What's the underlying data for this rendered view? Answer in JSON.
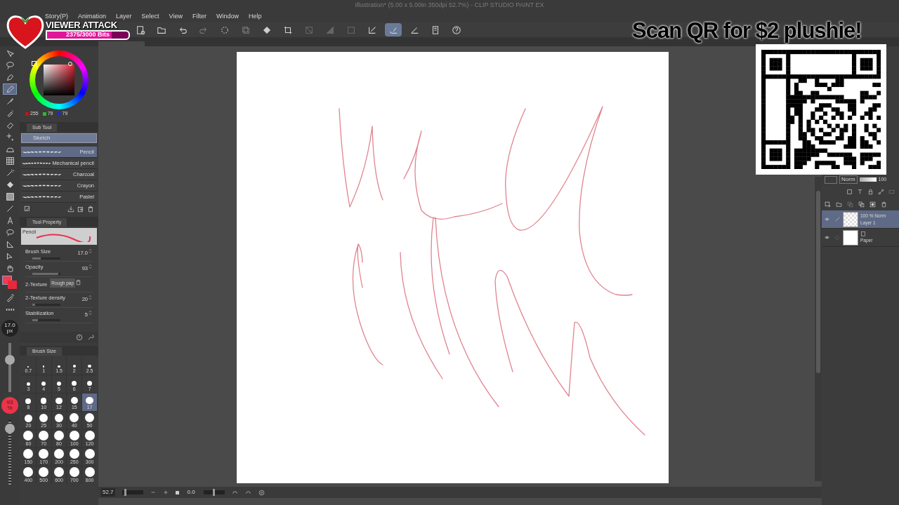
{
  "window": {
    "title": "Illustration* (5.00 x 5.00in 350dpi 52.7%) - CLIP STUDIO PAINT EX"
  },
  "menu": [
    "Story(P)",
    "Animation",
    "Layer",
    "Select",
    "View",
    "Filter",
    "Window",
    "Help"
  ],
  "toolbar": [
    {
      "selected": false
    },
    {
      "selected": false
    },
    {
      "selected": false
    },
    {
      "selected": false
    },
    {
      "selected": false
    },
    {
      "selected": false
    },
    {
      "selected": false
    },
    {
      "selected": false
    },
    {
      "selected": false
    },
    {
      "selected": false
    },
    {
      "selected": false
    },
    {
      "selected": false
    },
    {
      "selected": true
    },
    {
      "selected": false
    },
    {
      "selected": false
    },
    {
      "selected": false
    }
  ],
  "tools": [
    {
      "selected": false
    },
    {
      "selected": false
    },
    {
      "selected": false
    },
    {
      "selected": true
    },
    {
      "selected": false
    },
    {
      "selected": false
    },
    {
      "selected": false
    },
    {
      "selected": false
    },
    {
      "selected": false
    },
    {
      "selected": false
    },
    {
      "selected": false
    },
    {
      "selected": false
    },
    {
      "selected": false
    },
    {
      "selected": false
    },
    {
      "selected": false
    },
    {
      "selected": false
    },
    {
      "selected": false
    },
    {
      "selected": false
    },
    {
      "selected": false
    },
    {
      "selected": false
    },
    {
      "selected": false
    }
  ],
  "color": {
    "r": "255",
    "g": "79",
    "b": "79"
  },
  "sub_tool": {
    "tab": "Sub Tool",
    "group": "Sketch",
    "items": [
      {
        "label": "Pencil",
        "selected": true
      },
      {
        "label": "Mechanical pencil",
        "selected": false
      },
      {
        "label": "Charcoal",
        "selected": false
      },
      {
        "label": "Crayon",
        "selected": false
      },
      {
        "label": "Pastel",
        "selected": false
      }
    ]
  },
  "tool_property": {
    "tab": "Tool Property",
    "preset": "Pencil",
    "properties": [
      {
        "kind": "slider",
        "label": "Brush Size",
        "value": "17.0",
        "level": 0.3
      },
      {
        "kind": "slider",
        "label": "Opacity",
        "value": "93",
        "level": 0.93
      },
      {
        "kind": "texture",
        "label": "2-Texture",
        "value": "Rough pap"
      },
      {
        "kind": "slider",
        "label": "2-Texture density",
        "value": "20",
        "level": 0.1
      },
      {
        "kind": "slider",
        "label": "Stabilization",
        "value": "5",
        "level": 0.2
      }
    ]
  },
  "brush_size_slider": {
    "value": "17.0",
    "unit": "px",
    "level": 0.7
  },
  "opacity_slider": {
    "value": "93",
    "unit": "%",
    "level": 0.93
  },
  "brush_size_palette": {
    "tab": "Brush Size",
    "sizes": [
      {
        "label": "0.7",
        "selected": false
      },
      {
        "label": "1",
        "selected": false
      },
      {
        "label": "1.5",
        "selected": false
      },
      {
        "label": "2",
        "selected": false
      },
      {
        "label": "2.5",
        "selected": false
      },
      {
        "label": "3",
        "selected": false
      },
      {
        "label": "4",
        "selected": false
      },
      {
        "label": "5",
        "selected": false
      },
      {
        "label": "6",
        "selected": false
      },
      {
        "label": "7",
        "selected": false
      },
      {
        "label": "8",
        "selected": false
      },
      {
        "label": "10",
        "selected": false
      },
      {
        "label": "12",
        "selected": false
      },
      {
        "label": "15",
        "selected": false
      },
      {
        "label": "17",
        "selected": true
      },
      {
        "label": "20",
        "selected": false
      },
      {
        "label": "25",
        "selected": false
      },
      {
        "label": "30",
        "selected": false
      },
      {
        "label": "40",
        "selected": false
      },
      {
        "label": "50",
        "selected": false
      },
      {
        "label": "60",
        "selected": false
      },
      {
        "label": "70",
        "selected": false
      },
      {
        "label": "80",
        "selected": false
      },
      {
        "label": "100",
        "selected": false
      },
      {
        "label": "120",
        "selected": false
      },
      {
        "label": "150",
        "selected": false
      },
      {
        "label": "170",
        "selected": false
      },
      {
        "label": "200",
        "selected": false
      },
      {
        "label": "250",
        "selected": false
      },
      {
        "label": "300",
        "selected": false
      },
      {
        "label": "400",
        "selected": false
      },
      {
        "label": "500",
        "selected": false
      },
      {
        "label": "600",
        "selected": false
      },
      {
        "label": "700",
        "selected": false
      },
      {
        "label": "800",
        "selected": false
      }
    ]
  },
  "layers": {
    "blend": "Norm",
    "opacity": {
      "value": "100",
      "level": 1
    },
    "items": [
      {
        "name": "Layer 1",
        "info": "100 % Norm",
        "selected": true,
        "visible": true
      },
      {
        "name": "Paper",
        "selected": false,
        "visible": true
      }
    ]
  },
  "status_bar": {
    "zoom": {
      "value": "52.7",
      "level": 0.12
    },
    "angle": {
      "value": "0.0",
      "level": 0.5
    }
  },
  "overlay": {
    "title": "VIEWER ATTACK",
    "bits": "2375/3000 Bits",
    "level": 0.79,
    "caption": "Scan QR for $2 plushie!"
  }
}
